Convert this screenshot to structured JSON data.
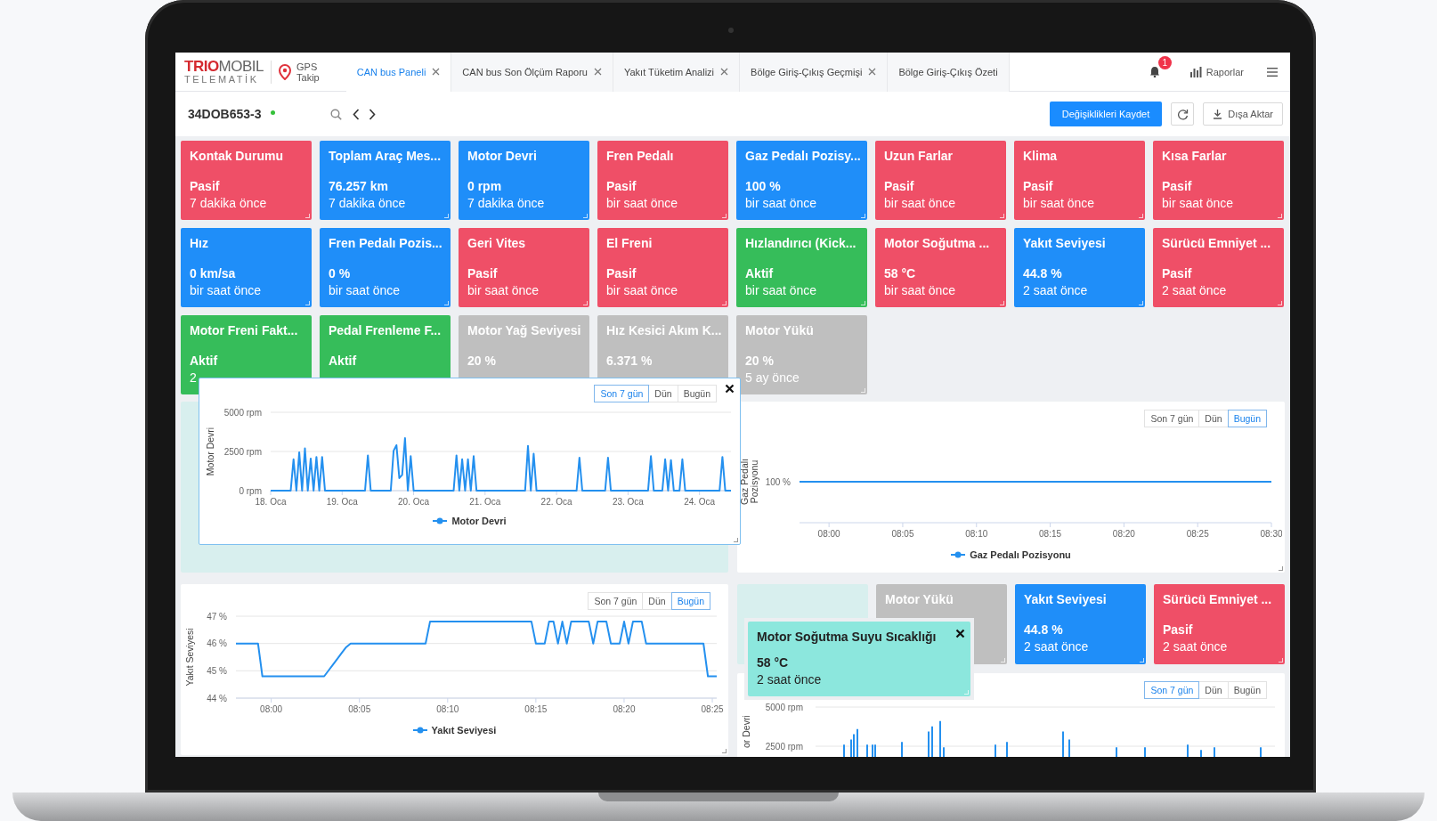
{
  "header": {
    "logo": "**TRIO**MOBIL",
    "logo_subtitle": "TELEMATİK",
    "app_line_1": "GPS",
    "app_line_2": "Takip",
    "tabs": [
      {
        "label": "CAN bus Paneli",
        "selected": true,
        "closable": true
      },
      {
        "label": "CAN bus Son Ölçüm Raporu",
        "selected": false,
        "closable": true
      },
      {
        "label": "Yakıt Tüketim Analizi",
        "selected": false,
        "closable": true
      },
      {
        "label": "Bölge Giriş-Çıkış Geçmişi",
        "selected": false,
        "closable": true
      },
      {
        "label": "Bölge Giriş-Çıkış Özeti",
        "selected": false,
        "closable": false
      }
    ],
    "notification_count": "1",
    "reports_link": "Raporlar"
  },
  "toolbar": {
    "vehicle": "34DOB653-3",
    "online": true,
    "save_button": "Değişiklikleri Kaydet",
    "export_button": "Dışa Aktar"
  },
  "cards": [
    {
      "title": "Kontak Durumu",
      "value": "Pasif",
      "time": "7 dakika önce",
      "color": "#ef4f67"
    },
    {
      "title": "Toplam Araç Mes...",
      "value": "76.257 km",
      "time": "7 dakika önce",
      "color": "#1f8ef9"
    },
    {
      "title": "Motor Devri",
      "value": "0 rpm",
      "time": "7 dakika önce",
      "color": "#1f8ef9"
    },
    {
      "title": "Fren Pedalı",
      "value": "Pasif",
      "time": "bir saat önce",
      "color": "#ef4f67"
    },
    {
      "title": "Gaz Pedalı Pozisy...",
      "value": "100 %",
      "time": "bir saat önce",
      "color": "#1f8ef9"
    },
    {
      "title": "Uzun Farlar",
      "value": "Pasif",
      "time": "bir saat önce",
      "color": "#ef4f67"
    },
    {
      "title": "Klima",
      "value": "Pasif",
      "time": "bir saat önce",
      "color": "#ef4f67"
    },
    {
      "title": "Kısa Farlar",
      "value": "Pasif",
      "time": "bir saat önce",
      "color": "#ef4f67"
    },
    {
      "title": "Hız",
      "value": "0 km/sa",
      "time": "bir saat önce",
      "color": "#1f8ef9"
    },
    {
      "title": "Fren Pedalı Pozis...",
      "value": "0 %",
      "time": "bir saat önce",
      "color": "#1f8ef9"
    },
    {
      "title": "Geri Vites",
      "value": "Pasif",
      "time": "bir saat önce",
      "color": "#ef4f67"
    },
    {
      "title": "El Freni",
      "value": "Pasif",
      "time": "bir saat önce",
      "color": "#ef4f67"
    },
    {
      "title": "Hızlandırıcı (Kick...",
      "value": "Aktif",
      "time": "bir saat önce",
      "color": "#36bd5a"
    },
    {
      "title": "Motor Soğutma ...",
      "value": "58 °C",
      "time": "bir saat önce",
      "color": "#ef4f67"
    },
    {
      "title": "Yakıt Seviyesi",
      "value": "44.8 %",
      "time": "2 saat önce",
      "color": "#1f8ef9"
    },
    {
      "title": "Sürücü Emniyet ...",
      "value": "Pasif",
      "time": "2 saat önce",
      "color": "#ef4f67"
    },
    {
      "title": "Motor Freni Fakt...",
      "value": "Aktif",
      "time": "2",
      "color": "#36bd5a"
    },
    {
      "title": "Pedal Frenleme F...",
      "value": "Aktif",
      "color": "#36bd5a"
    },
    {
      "title": "Motor Yağ Seviyesi",
      "value": "20 %",
      "color": "#bfbfbf"
    },
    {
      "title": "Hız Kesici Akım K...",
      "value": "6.371 %",
      "color": "#bfbfbf"
    },
    {
      "title": "Motor Yükü",
      "value": "20 %",
      "time": "5 ay önce",
      "color": "#bfbfbf"
    }
  ],
  "dragged_chart": {
    "range_buttons": [
      {
        "label": "Son 7 gün",
        "selected": true
      },
      {
        "label": "Dün",
        "selected": false
      },
      {
        "label": "Bugün",
        "selected": false
      }
    ],
    "chart_data": {
      "type": "line",
      "ylabel": "Motor Devri",
      "categories": [
        "18. Oca",
        null,
        null,
        null,
        null,
        null,
        null,
        null,
        null,
        null,
        null,
        null,
        null,
        null,
        null,
        null,
        null,
        null,
        null,
        null,
        null,
        null,
        null,
        null,
        null,
        "19. Oca",
        null,
        null,
        null,
        null,
        null,
        null,
        null,
        null,
        null,
        null,
        null,
        null,
        null,
        null,
        null,
        null,
        null,
        null,
        null,
        null,
        null,
        null,
        null,
        null,
        "20. Oca",
        null,
        null,
        null,
        null,
        null,
        null,
        null,
        null,
        null,
        null,
        null,
        null,
        null,
        null,
        null,
        null,
        null,
        null,
        null,
        null,
        null,
        null,
        null,
        null,
        "21. Oca",
        null,
        null,
        null,
        null,
        null,
        null,
        null,
        null,
        null,
        null,
        null,
        null,
        null,
        null,
        null,
        null,
        null,
        null,
        null,
        null,
        null,
        null,
        null,
        null,
        "22. Oca",
        null,
        null,
        null,
        null,
        null,
        null,
        null,
        null,
        null,
        null,
        null,
        null,
        null,
        null,
        null,
        null,
        null,
        null,
        null,
        null,
        null,
        null,
        null,
        null,
        "23. Oca",
        null,
        null,
        null,
        null,
        null,
        null,
        null,
        null,
        null,
        null,
        null,
        null,
        null,
        null,
        null,
        null,
        null,
        null,
        null,
        null,
        null,
        null,
        null,
        null,
        "24. Oca",
        null,
        null,
        null,
        null,
        null,
        null,
        null,
        null,
        null,
        null,
        null
      ],
      "series": [
        {
          "name": "Motor Devri",
          "color": "#2490ef",
          "values": [
            0,
            0,
            0,
            0,
            0,
            0,
            0,
            0,
            2000,
            0,
            2450,
            0,
            2700,
            0,
            2050,
            0,
            2150,
            0,
            2150,
            0,
            0,
            0,
            0,
            0,
            0,
            0,
            0,
            0,
            0,
            0,
            0,
            0,
            0,
            0,
            2250,
            0,
            0,
            0,
            0,
            0,
            0,
            0,
            0,
            2550,
            2900,
            800,
            1000,
            3350,
            0,
            2200,
            0,
            0,
            0,
            0,
            0,
            0,
            0,
            0,
            0,
            0,
            0,
            0,
            0,
            0,
            0,
            2250,
            0,
            2000,
            0,
            2000,
            0,
            2200,
            0,
            0,
            0,
            0,
            0,
            0,
            0,
            0,
            0,
            0,
            0,
            0,
            0,
            0,
            0,
            0,
            0,
            0,
            2850,
            0,
            2350,
            0,
            0,
            0,
            0,
            0,
            0,
            0,
            0,
            0,
            0,
            0,
            0,
            0,
            0,
            0,
            2100,
            0,
            0,
            0,
            0,
            0,
            0,
            0,
            0,
            0,
            2100,
            0,
            0,
            0,
            0,
            0,
            0,
            0,
            0,
            0,
            0,
            0,
            0,
            0,
            0,
            2200,
            0,
            0,
            0,
            0,
            2000,
            0,
            1950,
            0,
            0,
            0,
            2000,
            0,
            0,
            0,
            0,
            0,
            0,
            0,
            0,
            0,
            0,
            0,
            0,
            0,
            2150,
            0,
            0,
            0
          ]
        }
      ],
      "ylim": [
        0,
        5000
      ],
      "yticks": [
        {
          "value": 0,
          "label": "0 rpm"
        },
        {
          "value": 2500,
          "label": "2500 rpm"
        },
        {
          "value": 5000,
          "label": "5000 rpm"
        }
      ]
    }
  },
  "upper_left_slot": {
    "kind": "placeholder"
  },
  "gas_chart": {
    "range_buttons": [
      {
        "label": "Son 7 gün",
        "selected": false
      },
      {
        "label": "Dün",
        "selected": false
      },
      {
        "label": "Bugün",
        "selected": true
      }
    ],
    "y_label": "Gaz Pedalı Pozisyonu",
    "x_labels": [
      "08:00",
      "08:05",
      "08:10",
      "08:15",
      "08:20",
      "08:25",
      "08:30"
    ],
    "legend": "Gaz Pedalı Pozisyonu",
    "line_label": "100 %"
  },
  "fuel_chart": {
    "range_buttons": [
      {
        "label": "Son 7 gün",
        "selected": false
      },
      {
        "label": "Dün",
        "selected": false
      },
      {
        "label": "Bugün",
        "selected": true
      }
    ],
    "chart_data": {
      "type": "line",
      "ylabel": "Yakıt Seviyesi",
      "categories": [
        null,
        null,
        null,
        null,
        null,
        null,
        null,
        null,
        "08:00",
        null,
        null,
        null,
        null,
        null,
        null,
        null,
        null,
        null,
        null,
        null,
        null,
        null,
        null,
        null,
        null,
        null,
        null,
        null,
        "08:05",
        null,
        null,
        null,
        null,
        null,
        null,
        null,
        null,
        null,
        null,
        null,
        null,
        null,
        null,
        null,
        null,
        null,
        null,
        null,
        "08:10",
        null,
        null,
        null,
        null,
        null,
        null,
        null,
        null,
        null,
        null,
        null,
        null,
        null,
        null,
        null,
        null,
        null,
        null,
        null,
        "08:15",
        null,
        null,
        null,
        null,
        null,
        null,
        null,
        null,
        null,
        null,
        null,
        null,
        null,
        null,
        null,
        null,
        null,
        null,
        null,
        "08:20",
        null,
        null,
        null,
        null,
        null,
        null,
        null,
        null,
        null,
        null,
        null,
        null,
        null,
        null,
        null,
        null,
        null,
        null,
        null,
        "08:25",
        null
      ],
      "series": [
        {
          "name": "Yakıt Seviyesi",
          "color": "#2490ef",
          "values": [
            46,
            46,
            46,
            46,
            46,
            46,
            44.8,
            44.8,
            44.8,
            44.8,
            44.8,
            44.8,
            44.8,
            44.8,
            44.8,
            44.8,
            44.8,
            44.8,
            44.8,
            44.8,
            44.8,
            45.01,
            45.23,
            45.44,
            45.66,
            45.87,
            46,
            46,
            46,
            46,
            46,
            46,
            46,
            46,
            46,
            46,
            46,
            46,
            46,
            46,
            46,
            46,
            46,
            46,
            46.8,
            46.8,
            46.8,
            46.8,
            46.8,
            46.8,
            46.8,
            46.8,
            46.8,
            46.8,
            46.8,
            46.8,
            46.8,
            46.8,
            46.8,
            46.8,
            46.8,
            46.8,
            46.8,
            46.8,
            46.8,
            46.8,
            46.8,
            46.8,
            46,
            46,
            46,
            46.8,
            46.8,
            46,
            46.8,
            46,
            46.8,
            46.8,
            46.8,
            46.8,
            46.8,
            46,
            46.8,
            46.8,
            46.8,
            46,
            46,
            46,
            46.8,
            46,
            46.8,
            46.8,
            46.8,
            46,
            46,
            46,
            46,
            46,
            46,
            46,
            46,
            46,
            46,
            46,
            46,
            46,
            46,
            44.8,
            44.8,
            44.8
          ]
        }
      ],
      "ylim": [
        44,
        47
      ],
      "yticks": [
        {
          "value": 44,
          "label": "44 %"
        },
        {
          "value": 45,
          "label": "45 %"
        },
        {
          "value": 46,
          "label": "46 %"
        },
        {
          "value": 47,
          "label": "47 %"
        }
      ]
    }
  },
  "lower_cards": [
    {
      "kind": "placeholder"
    },
    {
      "kind": "card",
      "title": "Motor Yükü",
      "color": "#bfbfbf"
    },
    {
      "kind": "card",
      "title": "Yakıt Seviyesi",
      "value": "44.8 %",
      "time": "2 saat önce",
      "color": "#1f8ef9"
    },
    {
      "kind": "card",
      "title": "Sürücü Emniyet ...",
      "value": "Pasif",
      "time": "2 saat önce",
      "color": "#ef4f67"
    }
  ],
  "dragged_card": {
    "title": "Motor Soğutma Suyu Sıcaklığı",
    "value": "58 °C",
    "time": "2 saat önce",
    "color": "#8ce7dd"
  },
  "rpm_chart": {
    "range_buttons": [
      {
        "label": "Son 7 gün",
        "selected": true
      },
      {
        "label": "Dün",
        "selected": false
      },
      {
        "label": "Bugün",
        "selected": false
      }
    ],
    "y_label": "or Devri",
    "y_ticks": [
      "5000 rpm",
      "2500 rpm"
    ]
  }
}
